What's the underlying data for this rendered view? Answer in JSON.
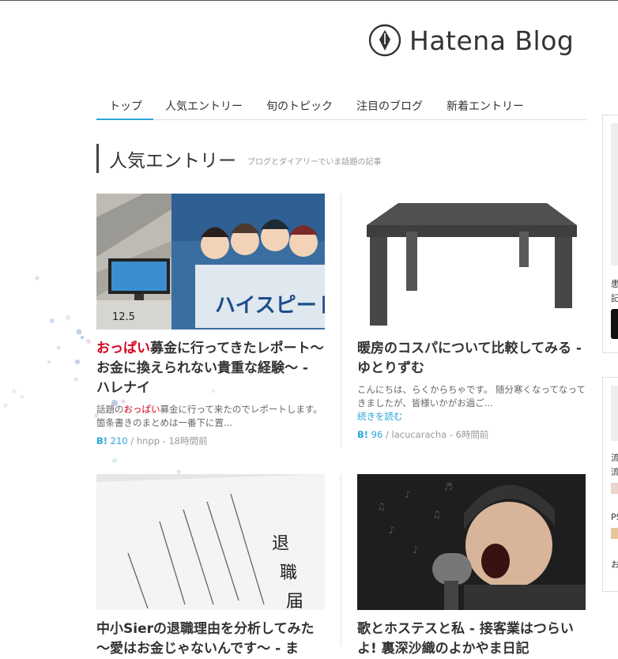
{
  "logo": {
    "text": "Hatena Blog"
  },
  "nav": {
    "tabs": [
      "トップ",
      "人気エントリー",
      "旬のトピック",
      "注目のブログ",
      "新着エントリー"
    ]
  },
  "section": {
    "title": "人気エントリー",
    "subtitle": "ブログとダイアリーでいま話題の記事"
  },
  "entries": [
    {
      "title_hl": "おっぱい",
      "title_rest": "募金に行ってきたレポート〜お金に換えられない貴重な経験〜 - ハレナイ",
      "excerpt_pre": "話題の",
      "excerpt_hl": "おっぱい",
      "excerpt_post": "募金に行って来たのでレポートします。箇条書きのまとめは一番下に置...",
      "b_mark": "B!",
      "count": "210",
      "sep": "/",
      "meta": "hnpp - 18時間前"
    },
    {
      "title": "暖房のコスパについて比較してみる - ゆとりずむ",
      "excerpt": "こんにちは、らくからちゃです。 随分寒くなってなってきましたが、皆様いかがお過ご...",
      "more": "続きを読む",
      "b_mark": "B!",
      "count": "96",
      "sep": "/",
      "meta": "lacucaracha - 6時間前"
    },
    {
      "title": "中小Sierの退職理由を分析してみた 〜愛はお金じゃないんです〜 - ま"
    },
    {
      "title": "歌とホステスと私 - 接客業はつらいよ! 裏深沙織のよかやま日記"
    }
  ],
  "sidebar": {
    "t1": "患",
    "t2": "記",
    "t3": "流",
    "t4": "流",
    "t5": "PS",
    "t6": "お"
  },
  "thumb3": {
    "line1": "退",
    "line2": "職",
    "line3": "届"
  },
  "thumb1": {
    "sign": "ハイスピード!"
  }
}
